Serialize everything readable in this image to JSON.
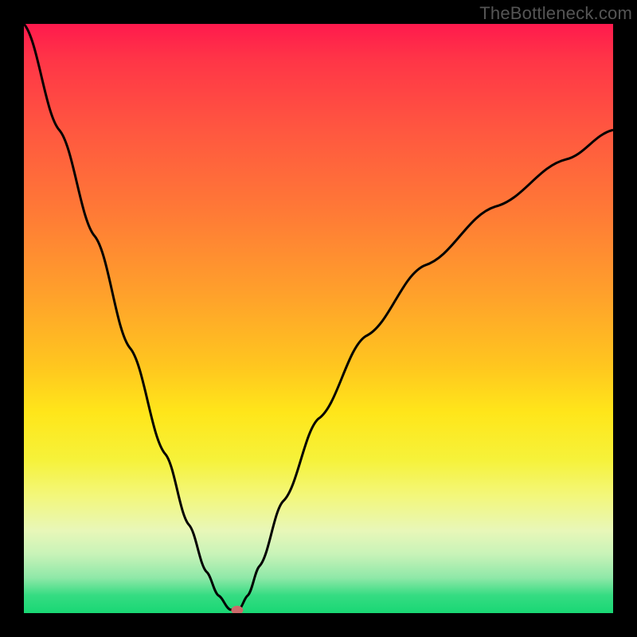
{
  "watermark": "TheBottleneck.com",
  "chart_data": {
    "type": "line",
    "title": "",
    "xlabel": "",
    "ylabel": "",
    "xlim": [
      0,
      100
    ],
    "ylim": [
      0,
      100
    ],
    "grid": false,
    "legend": false,
    "series": [
      {
        "name": "curve-left",
        "x": [
          0,
          6,
          12,
          18,
          24,
          28,
          31,
          33,
          35,
          36
        ],
        "values": [
          100,
          82,
          64,
          45,
          27,
          15,
          7,
          3,
          0.6,
          0.5
        ]
      },
      {
        "name": "curve-right",
        "x": [
          36.5,
          38,
          40,
          44,
          50,
          58,
          68,
          80,
          92,
          100
        ],
        "values": [
          0.6,
          3,
          8,
          19,
          33,
          47,
          59,
          69,
          77,
          82
        ]
      }
    ],
    "annotations": [
      {
        "name": "min-marker",
        "x": 36.2,
        "y": 0.5
      }
    ],
    "background_gradient_stops": [
      {
        "pos": 0,
        "color": "#ff1a4d"
      },
      {
        "pos": 18,
        "color": "#ff5740"
      },
      {
        "pos": 46,
        "color": "#ffa12b"
      },
      {
        "pos": 66,
        "color": "#ffe61a"
      },
      {
        "pos": 86,
        "color": "#e8f7b8"
      },
      {
        "pos": 100,
        "color": "#19d774"
      }
    ]
  }
}
